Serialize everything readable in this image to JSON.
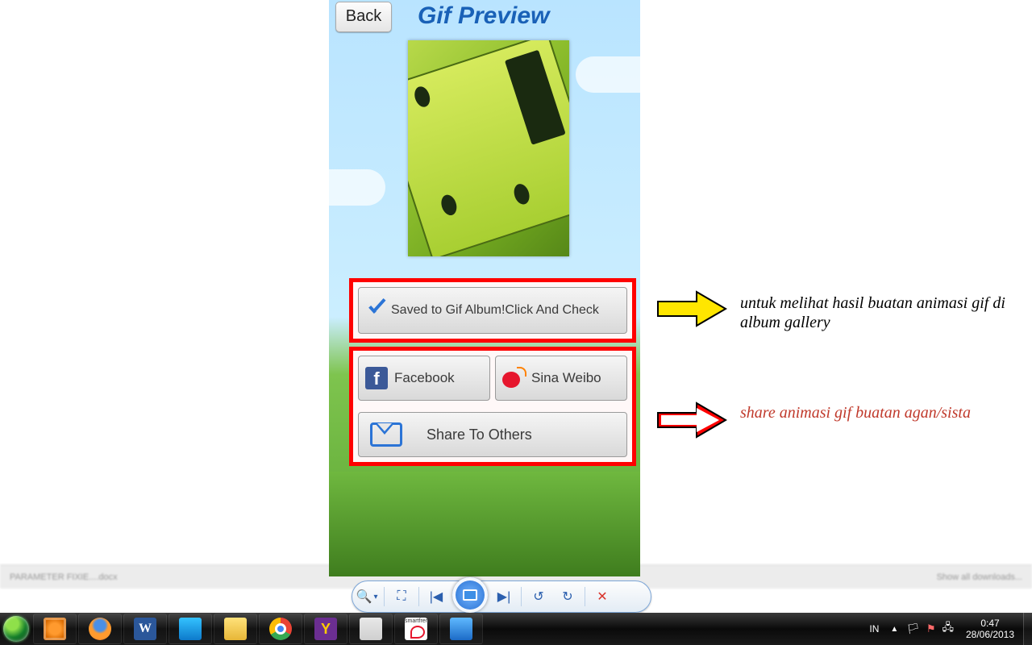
{
  "phone": {
    "back_label": "Back",
    "title": "Gif Preview",
    "saved_label": "Saved to Gif Album!Click And Check",
    "share": {
      "facebook": "Facebook",
      "weibo": "Sina Weibo",
      "others": "Share To Others"
    }
  },
  "annotations": {
    "a": "untuk melihat hasil buatan animasi gif di album gallery",
    "b": "share animasi gif buatan agan/sista"
  },
  "browser_strip": {
    "left": "PARAMETER FIXIE....docx",
    "right": "Show all downloads..."
  },
  "player": {
    "zoom": "🔍",
    "fit": "⛶",
    "prev": "|◀",
    "play": "▶",
    "next": "▶|",
    "ccw": "↺",
    "cw": "↻",
    "close": "✕"
  },
  "taskbar": {
    "lang": "IN",
    "clock_time": "0:47",
    "clock_date": "28/06/2013",
    "word_letter": "W",
    "ym_letter": "Y",
    "sf_label": "smartfren"
  }
}
